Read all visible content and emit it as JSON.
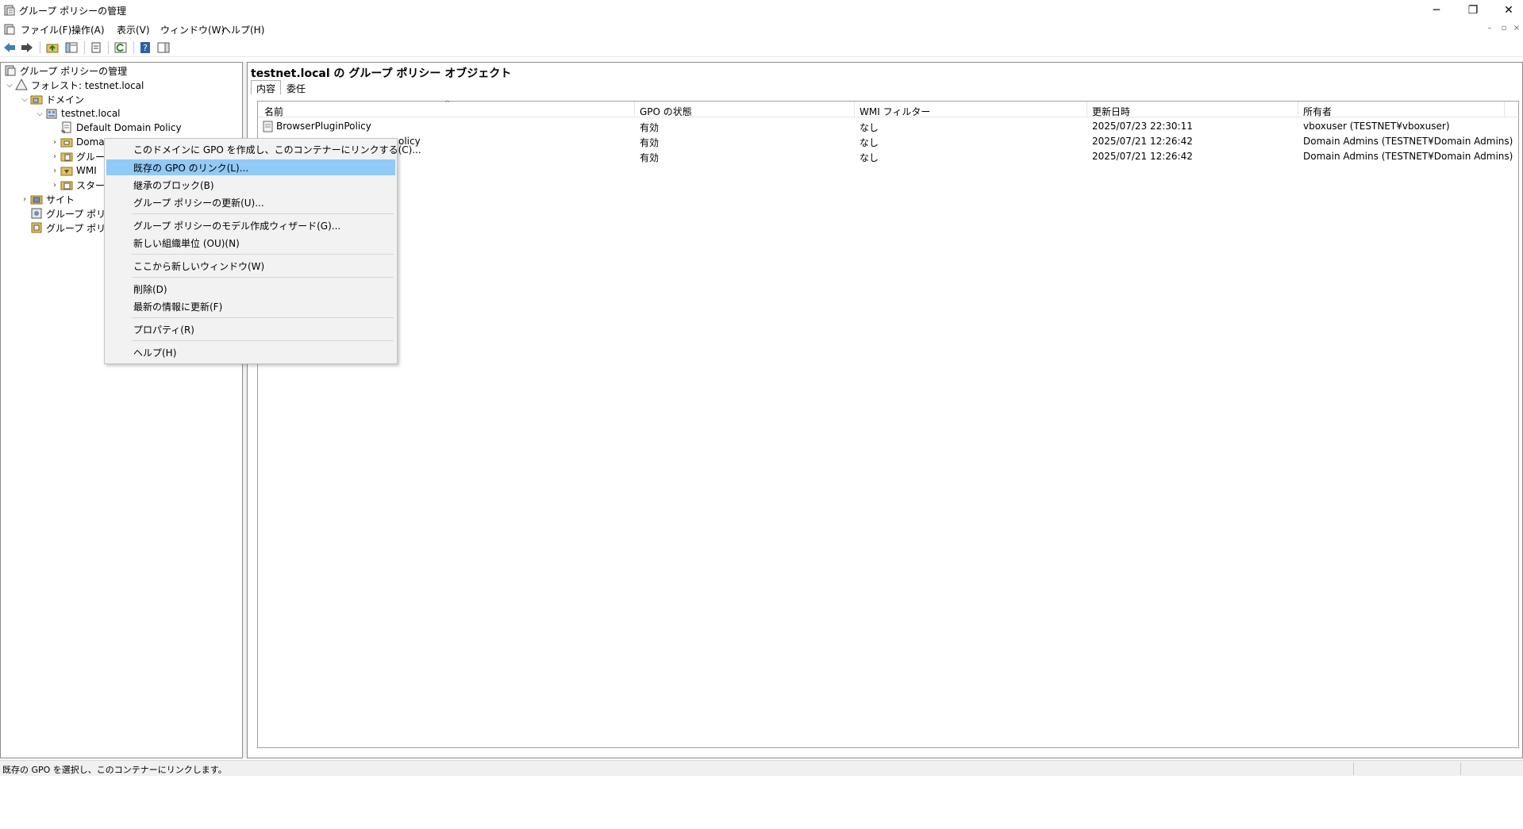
{
  "window": {
    "title": "グループ ポリシーの管理",
    "minimize": "─",
    "restore": "❐",
    "close": "✕"
  },
  "menu": {
    "items": [
      "ファイル(F)",
      "操作(A)",
      "表示(V)",
      "ウィンドウ(W)",
      "ヘルプ(H)"
    ],
    "mdi_min": "–",
    "mdi_restore": "▫",
    "mdi_close": "×"
  },
  "toolbar": {
    "icons": [
      "back-icon",
      "forward-icon",
      "up-folder-icon",
      "show-tree-icon",
      "properties-icon",
      "refresh-icon",
      "help-icon",
      "show-action-pane-icon"
    ]
  },
  "tree": {
    "root": "グループ ポリシーの管理",
    "forest": "フォレスト: testnet.local",
    "domains": "ドメイン",
    "domain": "testnet.local",
    "default_policy": "Default Domain Policy",
    "domain_controllers": "Doma",
    "group_policy_objects": "グループ",
    "wmi": "WMI",
    "starter": "スター",
    "sites": "サイト",
    "modeling": "グループ ポリシ",
    "results": "グループ ポリシ"
  },
  "content": {
    "header": "testnet.local の グループ ポリシー オブジェクト",
    "tabs": [
      "内容",
      "委任"
    ],
    "columns": [
      "名前",
      "GPO の状態",
      "WMI フィルター",
      "更新日時",
      "所有者"
    ],
    "rows": [
      {
        "name": "BrowserPluginPolicy",
        "status": "有効",
        "wmi": "なし",
        "modified": "2025/07/23 22:30:11",
        "owner": "vboxuser (TESTNET¥vboxuser)"
      },
      {
        "name": "olicy",
        "status": "有効",
        "wmi": "なし",
        "modified": "2025/07/21 12:26:42",
        "owner": "Domain Admins (TESTNET¥Domain Admins)"
      },
      {
        "name": "",
        "status": "有効",
        "wmi": "なし",
        "modified": "2025/07/21 12:26:42",
        "owner": "Domain Admins (TESTNET¥Domain Admins)"
      }
    ]
  },
  "context_menu": {
    "items": [
      "このドメインに GPO を作成し、このコンテナーにリンクする(C)...",
      "既存の GPO のリンク(L)...",
      "継承のブロック(B)",
      "グループ ポリシーの更新(U)...",
      "グループ ポリシーのモデル作成ウィザード(G)...",
      "新しい組織単位 (OU)(N)",
      "ここから新しいウィンドウ(W)",
      "削除(D)",
      "最新の情報に更新(F)",
      "プロパティ(R)",
      "ヘルプ(H)"
    ],
    "highlighted_index": 1
  },
  "status": {
    "text": "既存の GPO を選択し、このコンテナーにリンクします。"
  },
  "colors": {
    "highlight": "#91c9f7",
    "border": "#8c8c8c"
  }
}
